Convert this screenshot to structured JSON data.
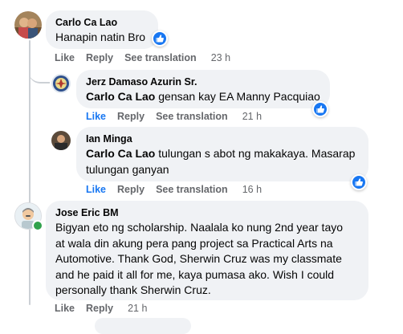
{
  "comments": [
    {
      "author": "Carlo Ca Lao",
      "text": "Hanapin natin Bro",
      "actions": {
        "like": "Like",
        "reply": "Reply",
        "translate": "See translation",
        "time": "23 h"
      },
      "avatar_icon": "person-photo-avatar",
      "reaction_icon": "like-reaction-icon"
    },
    {
      "author": "Jerz Damaso Azurin Sr.",
      "mention": "Carlo Ca Lao",
      "text": " gensan kay EA Manny Pacquiao",
      "actions": {
        "like": "Like",
        "reply": "Reply",
        "translate": "See translation",
        "time": "21 h"
      },
      "avatar_icon": "emblem-avatar",
      "reaction_icon": "like-reaction-icon"
    },
    {
      "author": "Ian Minga",
      "mention": "Carlo Ca Lao",
      "text_line1": " tulungan s abot ng makakaya. Masarap",
      "text_line2": "tulungan ganyan",
      "actions": {
        "like": "Like",
        "reply": "Reply",
        "translate": "See translation",
        "time": "16 h"
      },
      "avatar_icon": "person-photo-avatar",
      "reaction_icon": "like-reaction-icon"
    },
    {
      "author": "Jose Eric BM",
      "lines": [
        "Bigyan eto ng scholarship. Naalala ko nung 2nd year tayo",
        "at wala din akung pera pang project sa Practical Arts na",
        "Automotive. Thank God, Sherwin Cruz was my classmate",
        "and he paid it all for me, kaya pumasa ako. Wish I could",
        "personally thank Sherwin Cruz."
      ],
      "actions": {
        "like": "Like",
        "reply": "Reply",
        "time": "21 h"
      },
      "avatar_icon": "cartoon-avatar",
      "online_icon": "online-status-dot"
    }
  ],
  "colors": {
    "bubble": "#f0f2f5",
    "action_text": "#65676b",
    "like_blue": "#1877f2",
    "online_green": "#31a24c"
  }
}
